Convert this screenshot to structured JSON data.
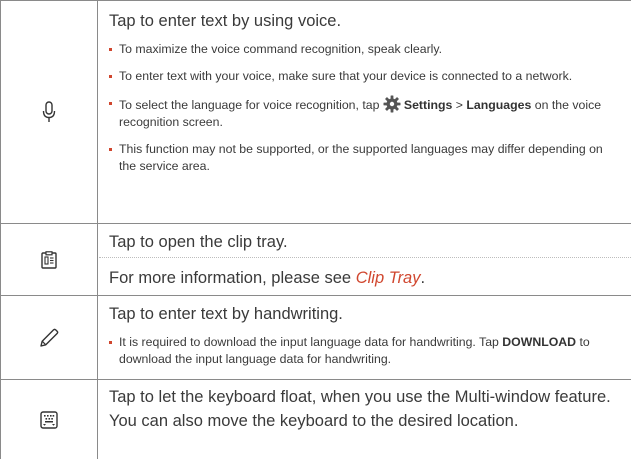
{
  "rows": [
    {
      "icon": "microphone-icon",
      "main": "Tap to enter text by using voice.",
      "bullets": [
        "To maximize the voice command recognition, speak clearly.",
        "To enter text with your voice, make sure that your device is connected to a network.",
        {
          "before": "To select the language for voice recognition, tap ",
          "settings": "Settings",
          "gt": " > ",
          "languages": "Languages",
          "after": " on the voice recognition screen."
        },
        "This function may not be supported, or the supported languages may differ depending on the service area."
      ]
    },
    {
      "icon": "clipboard-icon",
      "main": "Tap to open the clip tray.",
      "more_prefix": "For more information, please see ",
      "more_link": "Clip Tray",
      "more_suffix": "."
    },
    {
      "icon": "pencil-icon",
      "main": "Tap to enter text by handwriting.",
      "bullet_before": "It is required to download the input language data for handwriting. Tap ",
      "bullet_bold": "DOWNLOAD",
      "bullet_after": " to download the input language data for handwriting."
    },
    {
      "icon": "floating-keyboard-icon",
      "main": "Tap to let the keyboard float, when you use the Multi-window feature. You can also move the keyboard to the desired location."
    }
  ],
  "colors": {
    "accent": "#d0462e",
    "border": "#8a8a8a",
    "text": "#3a3a3a"
  }
}
